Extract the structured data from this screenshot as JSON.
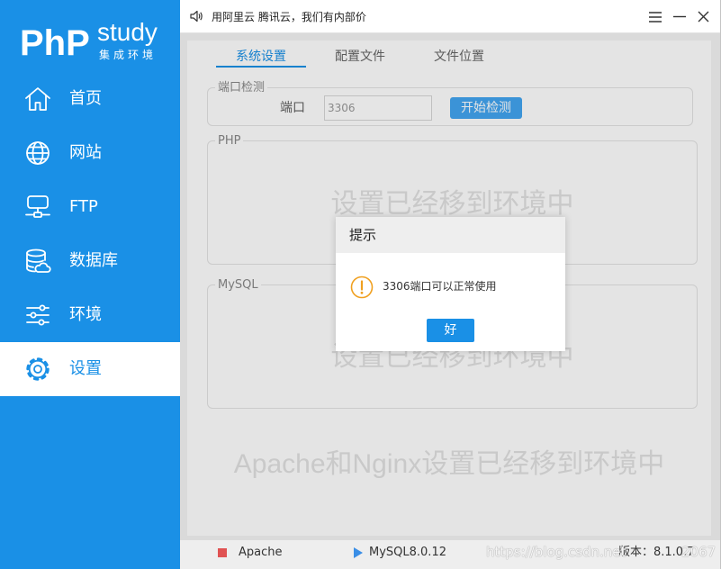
{
  "logo": {
    "main": "PhP",
    "sub": "study",
    "tagline": "集成环境"
  },
  "sidebar": {
    "items": [
      {
        "label": "首页",
        "icon": "home-icon",
        "active": false
      },
      {
        "label": "网站",
        "icon": "globe-icon",
        "active": false
      },
      {
        "label": "FTP",
        "icon": "ftp-icon",
        "active": false
      },
      {
        "label": "数据库",
        "icon": "database-icon",
        "active": false
      },
      {
        "label": "环境",
        "icon": "sliders-icon",
        "active": false
      },
      {
        "label": "设置",
        "icon": "gear-icon",
        "active": true
      }
    ]
  },
  "topbar": {
    "ad_icon": "speaker-icon",
    "ad_text": "用阿里云 腾讯云，我们有内部价",
    "controls": [
      "menu-icon",
      "minimize-icon",
      "close-icon"
    ]
  },
  "tabs": [
    {
      "label": "系统设置",
      "active": true
    },
    {
      "label": "配置文件",
      "active": false
    },
    {
      "label": "文件位置",
      "active": false
    }
  ],
  "port_check": {
    "legend": "端口检测",
    "label": "端口",
    "value": "3306",
    "button": "开始检测"
  },
  "php_section": {
    "legend": "PHP",
    "notice": "设置已经移到环境中"
  },
  "mysql_section": {
    "legend": "MySQL",
    "notice": "设置已经移到环境中"
  },
  "web_notice": "Apache和Nginx设置已经移到环境中",
  "statusbar": {
    "services": [
      {
        "name": "Apache",
        "icon": "stop-square-icon"
      },
      {
        "name": "MySQL8.0.12",
        "icon": "play-triangle-icon"
      }
    ],
    "version": "版本：8.1.0.7"
  },
  "dialog": {
    "title": "提示",
    "icon": "warning-icon",
    "message": "3306端口可以正常使用",
    "ok_label": "好"
  },
  "watermark": {
    "start": "https://blog.csdn.net",
    "end": "2067"
  },
  "colors": {
    "accent": "#1a90e6",
    "stop": "#e05252",
    "run": "#3a8ee6",
    "warning": "#f0a020"
  }
}
